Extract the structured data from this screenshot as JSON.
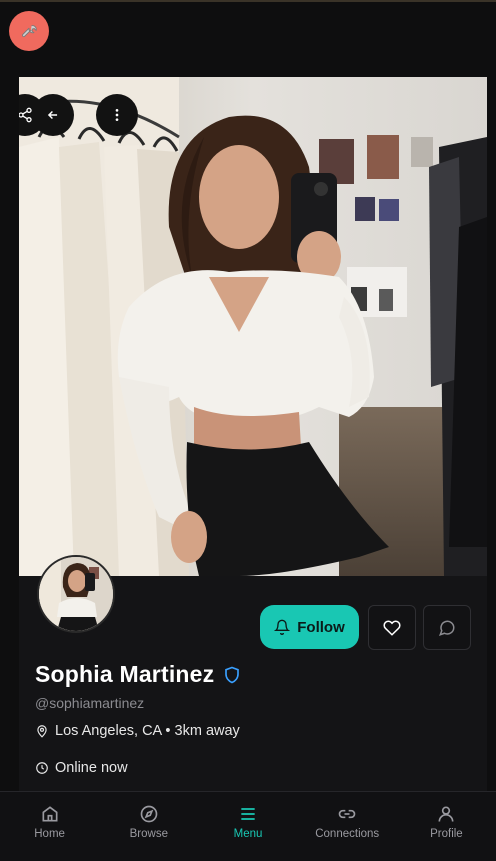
{
  "profile": {
    "name": "Sophia Martinez",
    "handle": "@sophiamartinez",
    "location": "Los Angeles, CA • 3km away",
    "status": "Online now"
  },
  "actions": {
    "follow_label": "Follow"
  },
  "nav": {
    "items": [
      {
        "label": "Home",
        "icon": "home-icon"
      },
      {
        "label": "Browse",
        "icon": "compass-icon"
      },
      {
        "label": "Menu",
        "icon": "menu-icon",
        "active": true
      },
      {
        "label": "Connections",
        "icon": "link-icon"
      },
      {
        "label": "Profile",
        "icon": "user-icon"
      }
    ]
  },
  "colors": {
    "accent": "#19c7b3",
    "tool_button": "#f06a5e",
    "verified": "#3aa0ff",
    "background": "#0e0e0f"
  }
}
